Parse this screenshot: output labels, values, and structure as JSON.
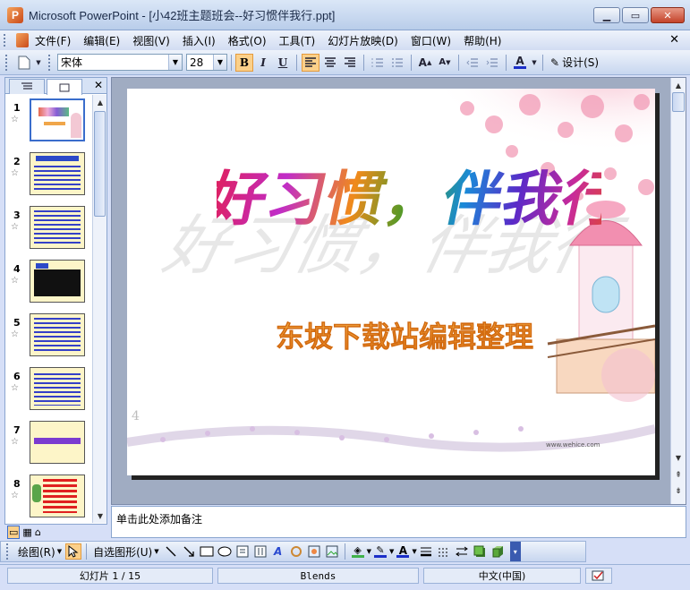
{
  "window": {
    "title": "Microsoft PowerPoint - [小42班主题班会--好习惯伴我行.ppt]",
    "minimize": "▁",
    "maximize": "▭",
    "close": "✕"
  },
  "menubar": {
    "items": [
      "文件(F)",
      "编辑(E)",
      "视图(V)",
      "插入(I)",
      "格式(O)",
      "工具(T)",
      "幻灯片放映(D)",
      "窗口(W)",
      "帮助(H)"
    ],
    "close": "✕"
  },
  "toolbar": {
    "font_name": "宋体",
    "font_size": "28",
    "bold": "B",
    "italic": "I",
    "underline": "U",
    "design_label": "设计(S)"
  },
  "slides_panel": {
    "slides": [
      {
        "num": "1",
        "kind": "title"
      },
      {
        "num": "2",
        "kind": "text"
      },
      {
        "num": "3",
        "kind": "text"
      },
      {
        "num": "4",
        "kind": "dark"
      },
      {
        "num": "5",
        "kind": "text"
      },
      {
        "num": "6",
        "kind": "text"
      },
      {
        "num": "7",
        "kind": "heading"
      },
      {
        "num": "8",
        "kind": "red"
      }
    ]
  },
  "slide": {
    "title": "好习惯，伴我行",
    "subtitle": "东坡下载站编辑整理",
    "watermark": "www.wehice.com"
  },
  "notes": {
    "placeholder": "单击此处添加备注"
  },
  "drawbar": {
    "draw_label": "绘图(R)",
    "autoshapes_label": "自选图形(U)"
  },
  "statusbar": {
    "slide_position": "幻灯片 1 / 15",
    "template": "Blends",
    "language": "中文(中国)"
  },
  "colors": {
    "selected_thumb_border": "#3a6dcc",
    "title_bar": "#b9cdea",
    "highlight": "#fbd08a"
  }
}
